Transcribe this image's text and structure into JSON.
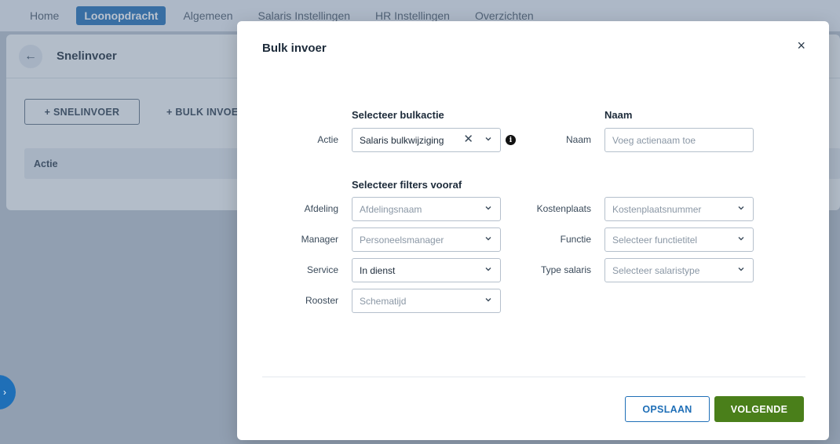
{
  "nav": {
    "items": [
      "Home",
      "Loonopdracht",
      "Algemeen",
      "Salaris Instellingen",
      "HR Instellingen",
      "Overzichten"
    ],
    "active_index": 1
  },
  "background": {
    "page_title": "Snelinvoer",
    "btn_snelinvoer": "+ SNELINVOER",
    "btn_bulk": "+ BULK INVOE",
    "table_header": "Actie"
  },
  "modal": {
    "title": "Bulk invoer",
    "close_glyph": "×",
    "section_bulkaction": "Selecteer bulkactie",
    "section_name": "Naam",
    "section_filters": "Selecteer filters vooraf",
    "actie": {
      "label": "Actie",
      "value": "Salaris bulkwijziging",
      "clear_glyph": "✕"
    },
    "naam": {
      "label": "Naam",
      "placeholder": "Voeg actienaam toe"
    },
    "afdeling": {
      "label": "Afdeling",
      "placeholder": "Afdelingsnaam"
    },
    "manager": {
      "label": "Manager",
      "placeholder": "Personeelsmanager"
    },
    "service": {
      "label": "Service",
      "value": "In dienst"
    },
    "rooster": {
      "label": "Rooster",
      "placeholder": "Schematijd"
    },
    "kostenplaats": {
      "label": "Kostenplaats",
      "placeholder": "Kostenplaatsnummer"
    },
    "functie": {
      "label": "Functie",
      "placeholder": "Selecteer functietitel"
    },
    "type_salaris": {
      "label": "Type salaris",
      "placeholder": "Selecteer salaristype"
    },
    "save_label": "OPSLAAN",
    "next_label": "VOLGENDE"
  },
  "colors": {
    "primary": "#1f6fb7",
    "success": "#4a7f1a"
  }
}
